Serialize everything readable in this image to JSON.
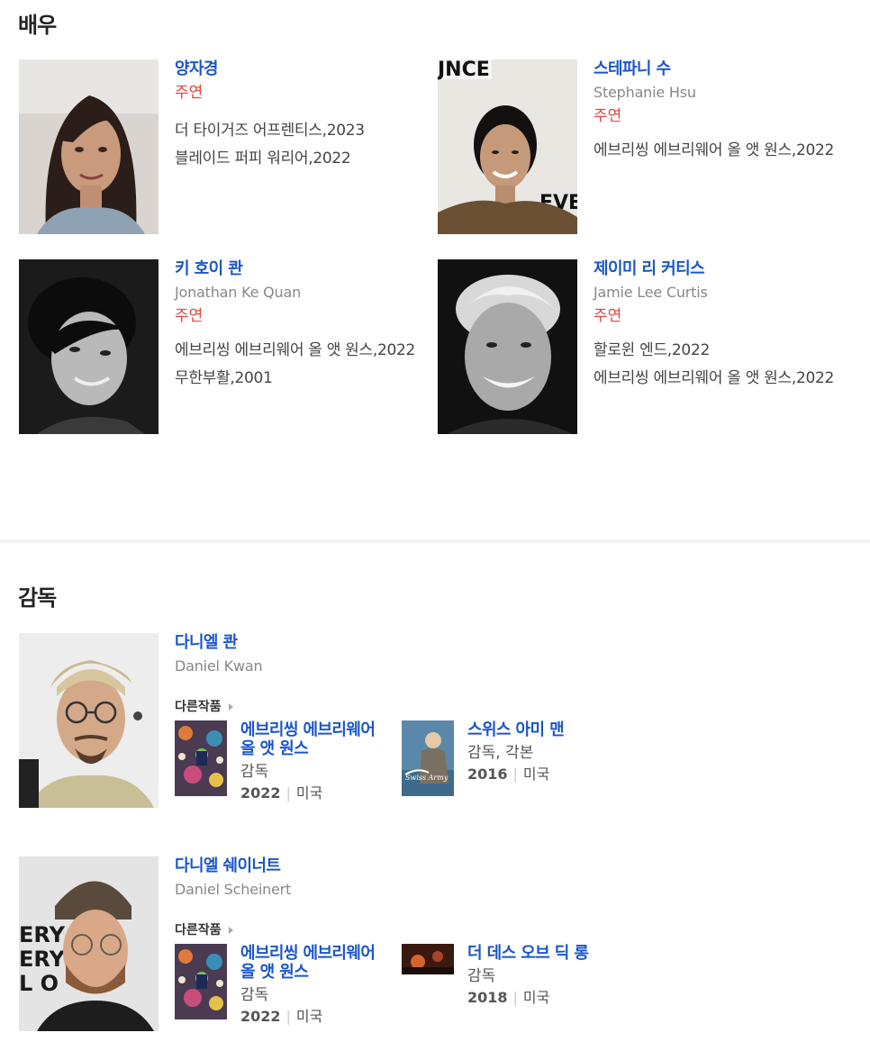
{
  "actors_section": {
    "title": "배우",
    "actors": [
      {
        "name": "양자경",
        "english_name": "",
        "role": "주연",
        "works": [
          "더 타이거즈 어프렌티스,2023",
          "블레이드 퍼피 워리어,2022"
        ]
      },
      {
        "name": "스테파니 수",
        "english_name": "Stephanie Hsu",
        "role": "주연",
        "works": [
          "에브리씽 에브리웨어 올 앳 원스,2022"
        ]
      },
      {
        "name": "키 호이 콴",
        "english_name": "Jonathan Ke Quan",
        "role": "주연",
        "works": [
          "에브리씽 에브리웨어 올 앳 원스,2022",
          "무한부활,2001"
        ]
      },
      {
        "name": "제이미 리 커티스",
        "english_name": "Jamie Lee Curtis",
        "role": "주연",
        "works": [
          "할로윈 엔드,2022",
          "에브리씽 에브리웨어 올 앳 원스,2022"
        ]
      }
    ]
  },
  "directors_section": {
    "title": "감독",
    "other_works_label": "다른작품",
    "directors": [
      {
        "name": "다니엘 콴",
        "english_name": "Daniel Kwan",
        "films": [
          {
            "title": "에브리씽 에브리웨어 올 앳 원스",
            "role": "감독",
            "year": "2022",
            "country": "미국"
          },
          {
            "title": "스위스 아미 맨",
            "role": "감독, 각본",
            "year": "2016",
            "country": "미국"
          }
        ]
      },
      {
        "name": "다니엘 쉐이너트",
        "english_name": "Daniel Scheinert",
        "films": [
          {
            "title": "에브리씽 에브리웨어 올 앳 원스",
            "role": "감독",
            "year": "2022",
            "country": "미국"
          },
          {
            "title": "더 데스 오브 딕 롱",
            "role": "감독",
            "year": "2018",
            "country": "미국"
          }
        ]
      }
    ]
  },
  "colors": {
    "link": "#1a56c8",
    "role": "#e8413c",
    "muted": "#888888"
  }
}
